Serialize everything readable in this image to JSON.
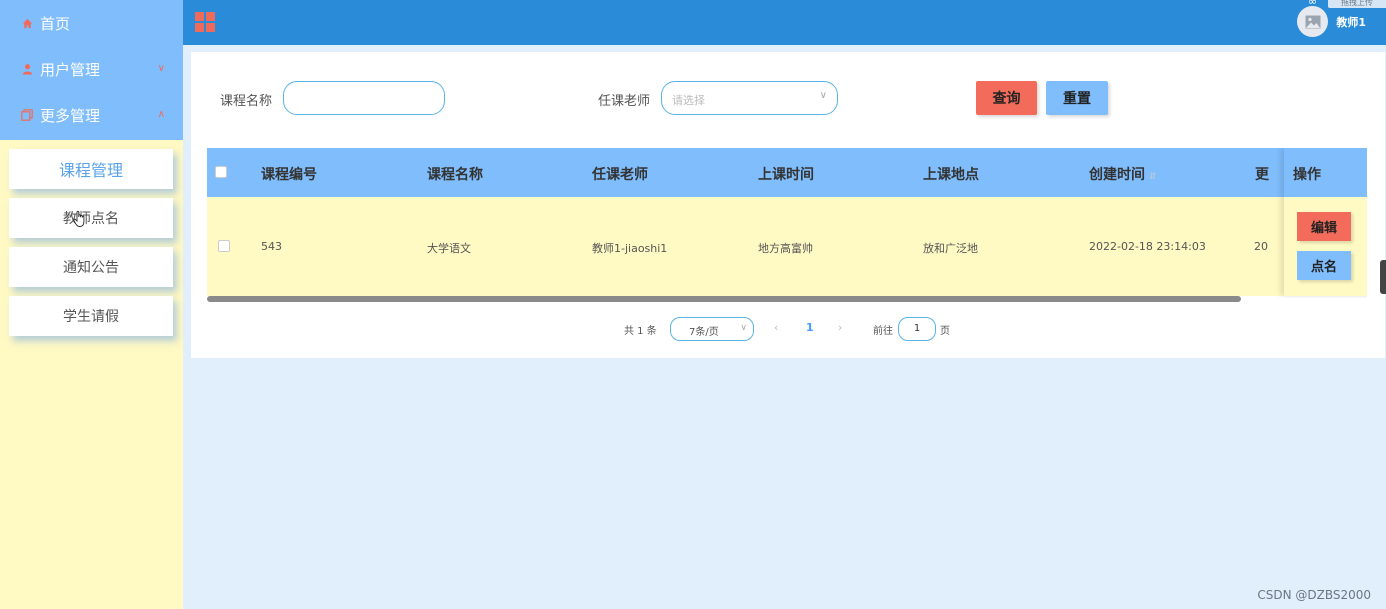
{
  "sidebar": {
    "menu": [
      {
        "label": "首页",
        "icon": "home-icon"
      },
      {
        "label": "用户管理",
        "icon": "user-icon"
      },
      {
        "label": "更多管理",
        "icon": "copy-icon"
      }
    ],
    "sub_items": [
      {
        "label": "课程管理",
        "active": true
      },
      {
        "label": "教师点名"
      },
      {
        "label": "通知公告"
      },
      {
        "label": "学生请假"
      }
    ]
  },
  "header": {
    "user_name": "教师1",
    "upload_label": "拖拽上传"
  },
  "search": {
    "course_name_label": "课程名称",
    "course_name_value": "",
    "teacher_label": "任课老师",
    "teacher_placeholder": "请选择",
    "query_button": "查询",
    "reset_button": "重置"
  },
  "table": {
    "columns": [
      "课程编号",
      "课程名称",
      "任课老师",
      "上课时间",
      "上课地点",
      "创建时间",
      "更"
    ],
    "ops_header": "操作",
    "rows": [
      {
        "cells": [
          "543",
          "大学语文",
          "教师1-jiaoshi1",
          "地方高富帅",
          "放和广泛地",
          "2022-02-18 23:14:03",
          "20"
        ],
        "edit_button": "编辑",
        "rollcall_button": "点名"
      }
    ]
  },
  "pagination": {
    "total_text": "共 1 条",
    "page_size": "7条/页",
    "current_page": "1",
    "goto_label": "前往",
    "goto_value": "1",
    "page_unit": "页"
  },
  "watermark": "CSDN @DZBS2000",
  "colors": {
    "sidebar_top": "#7fbdfc",
    "sidebar_bg": "#fff9c4",
    "header": "#2a8bd8",
    "accent_red": "#f36c5b",
    "accent_blue": "#7fbdfc"
  }
}
